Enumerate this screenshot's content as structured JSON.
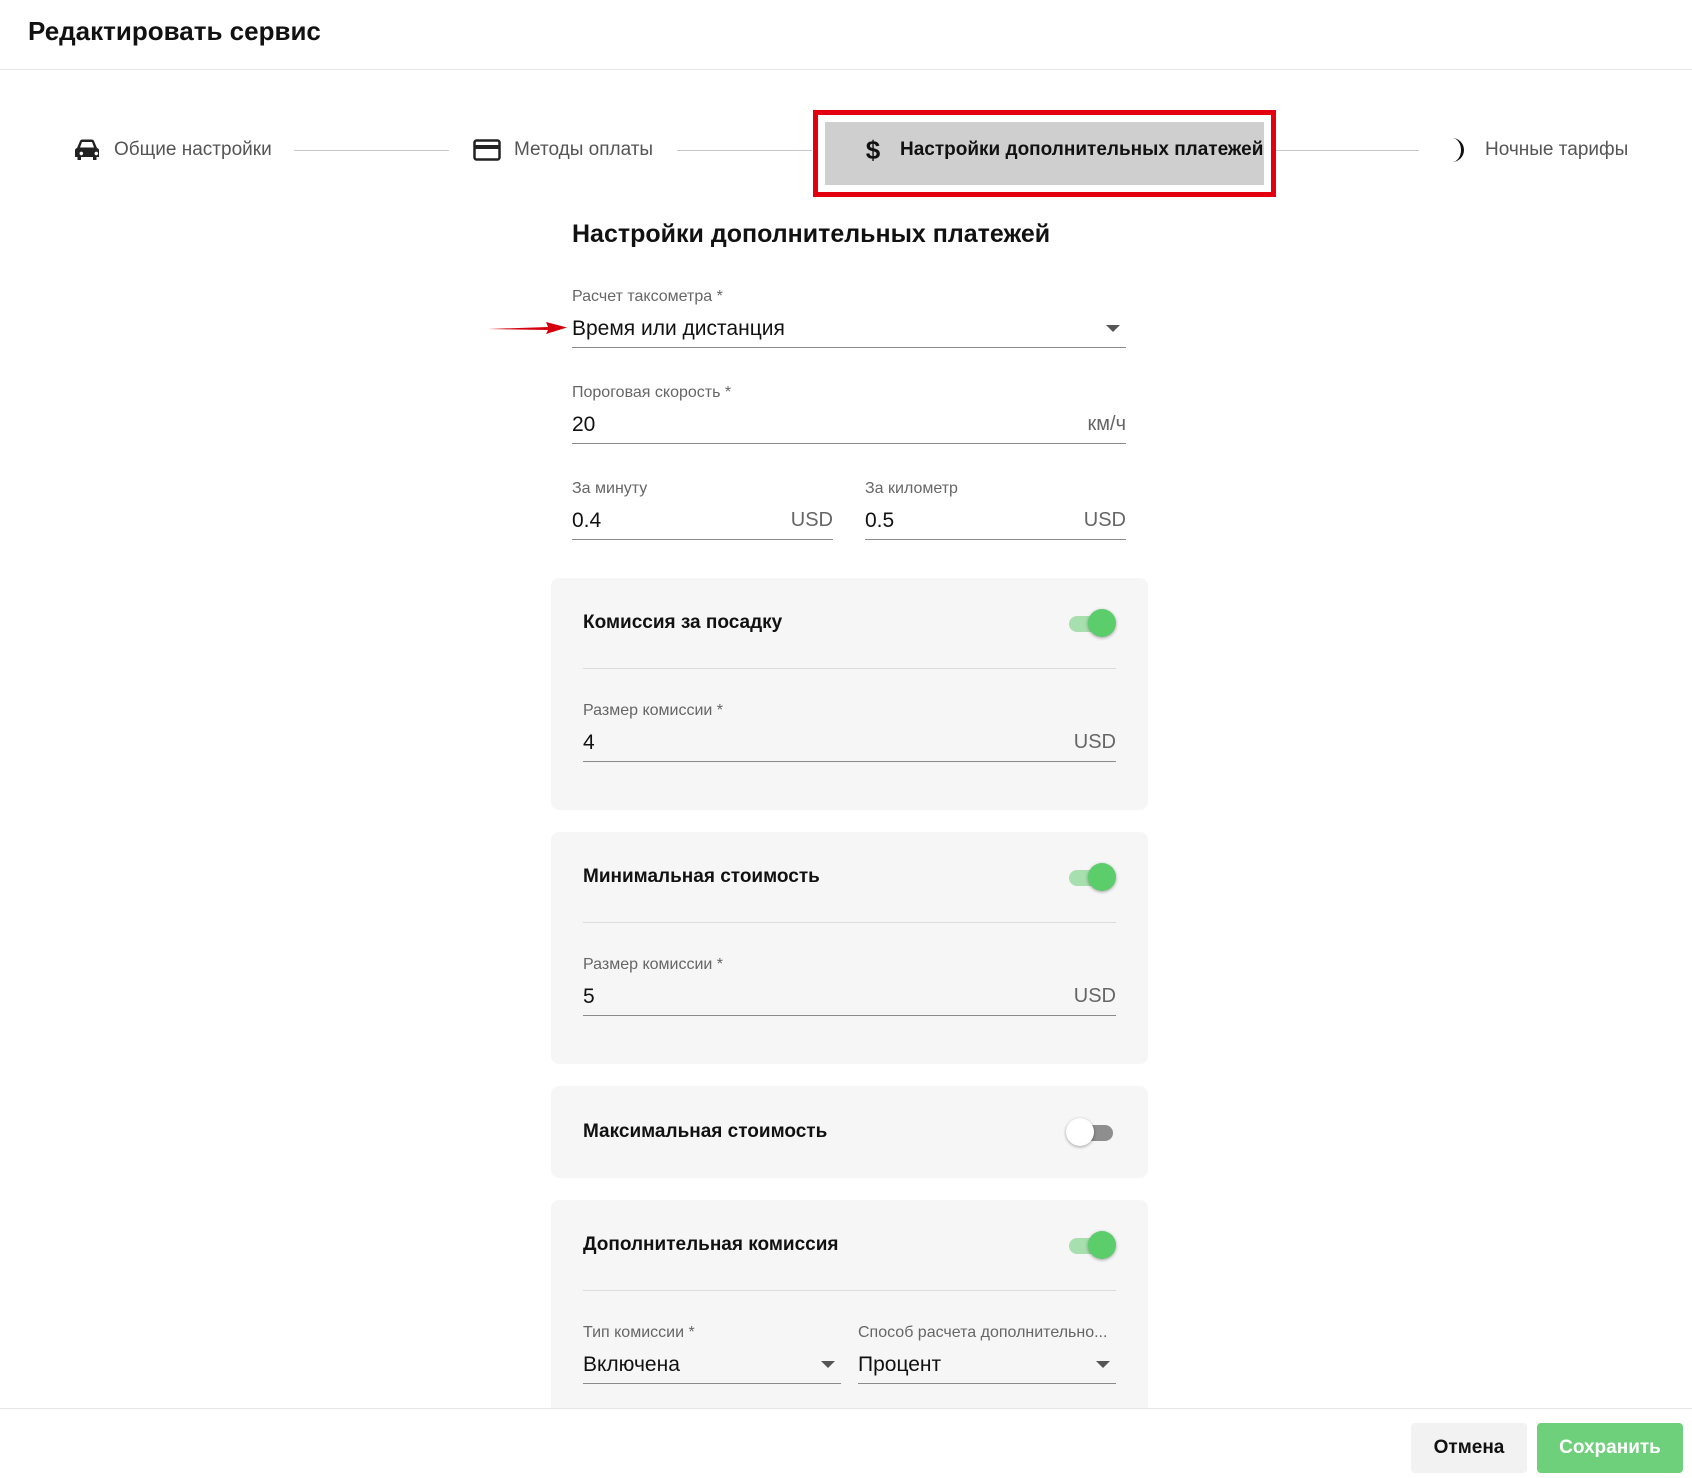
{
  "header": {
    "title": "Редактировать сервис"
  },
  "stepper": {
    "steps": [
      {
        "label": "Общие настройки",
        "icon": "car-icon"
      },
      {
        "label": "Методы оплаты",
        "icon": "credit-card-icon"
      },
      {
        "label": "Настройки дополнительных платежей",
        "icon": "dollar-icon",
        "active": true
      },
      {
        "label": "Ночные тарифы",
        "icon": "moon-icon"
      }
    ]
  },
  "section": {
    "title": "Настройки дополнительных платежей"
  },
  "taximeter": {
    "label": "Расчет таксометра *",
    "value": "Время или дистанция"
  },
  "threshold_speed": {
    "label": "Пороговая скорость *",
    "value": "20",
    "suffix": "км/ч"
  },
  "per_minute": {
    "label": "За минуту",
    "value": "0.4",
    "suffix": "USD"
  },
  "per_km": {
    "label": "За километр",
    "value": "0.5",
    "suffix": "USD"
  },
  "boarding_fee": {
    "title": "Комиссия за посадку",
    "enabled": true,
    "amount_label": "Размер комиссии *",
    "amount_value": "4",
    "suffix": "USD"
  },
  "min_cost": {
    "title": "Минимальная стоимость",
    "enabled": true,
    "amount_label": "Размер комиссии *",
    "amount_value": "5",
    "suffix": "USD"
  },
  "max_cost": {
    "title": "Максимальная стоимость",
    "enabled": false
  },
  "extra_fee": {
    "title": "Дополнительная комиссия",
    "enabled": true,
    "type_label": "Тип комиссии *",
    "type_value": "Включена",
    "method_label": "Способ расчета дополнительно...",
    "method_value": "Процент"
  },
  "footer": {
    "cancel_label": "Отмена",
    "save_label": "Сохранить"
  },
  "colors": {
    "accent_green": "#5ccd6b",
    "highlight_red": "#e3000f",
    "active_step_bg": "#cfcfcf"
  }
}
